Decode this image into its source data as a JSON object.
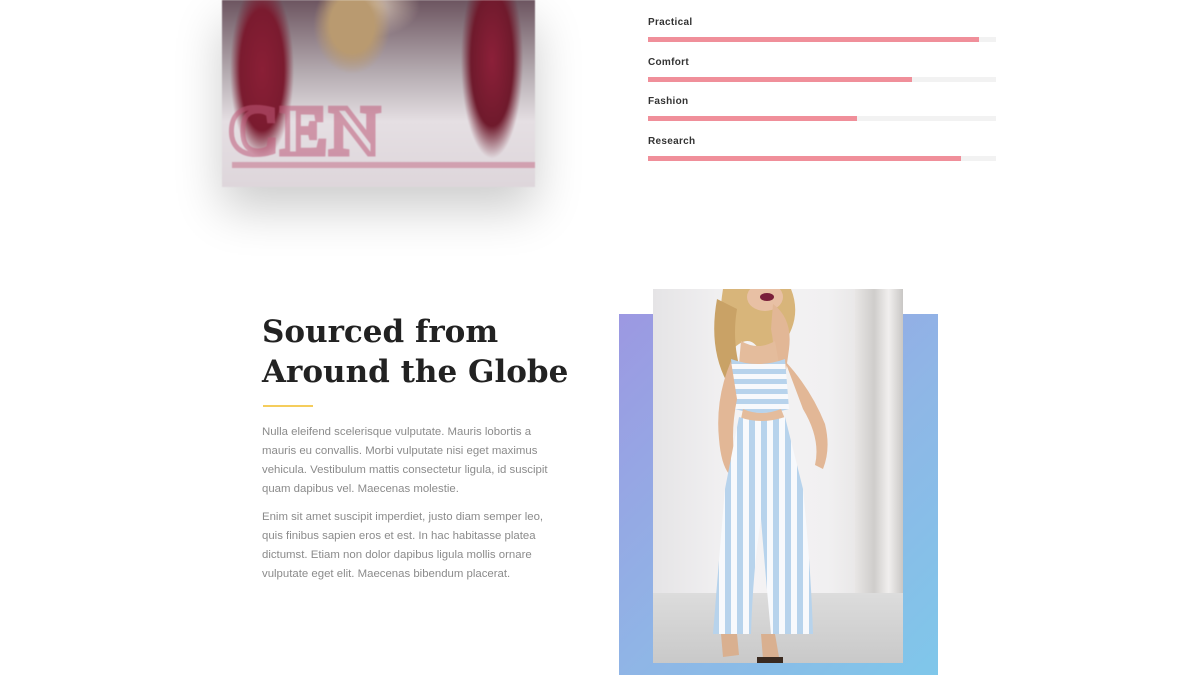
{
  "skills": [
    {
      "label": "Practical",
      "fill": 0.95
    },
    {
      "label": "Comfort",
      "fill": 0.76
    },
    {
      "label": "Fashion",
      "fill": 0.6
    },
    {
      "label": "Research",
      "fill": 0.9
    }
  ],
  "section": {
    "heading": "Sourced from Around the Globe",
    "paragraph1": "Nulla eleifend scelerisque vulputate. Mauris lobortis a mauris eu convallis. Morbi vulputate nisi eget maximus vehicula. Vestibulum mattis consectetur ligula, id suscipit quam dapibus vel. Maecenas molestie.",
    "paragraph2": "Enim sit amet suscipit imperdiet, justo diam semper leo, quis finibus sapien eros et est. In hac habitasse platea dictumst. Etiam non dolor dapibus ligula mollis ornare vulputate eget elit. Maecenas bibendum placerat."
  },
  "colors": {
    "bar_fill": "#f08f9a",
    "bar_track": "#f2f2f2",
    "divider": "#f5cd5c",
    "frame_gradient_start": "#9c98e2",
    "frame_gradient_end": "#7fc7ea"
  },
  "images": {
    "top_photo": "portrait-photo",
    "main_photo": "fashion-photo"
  }
}
